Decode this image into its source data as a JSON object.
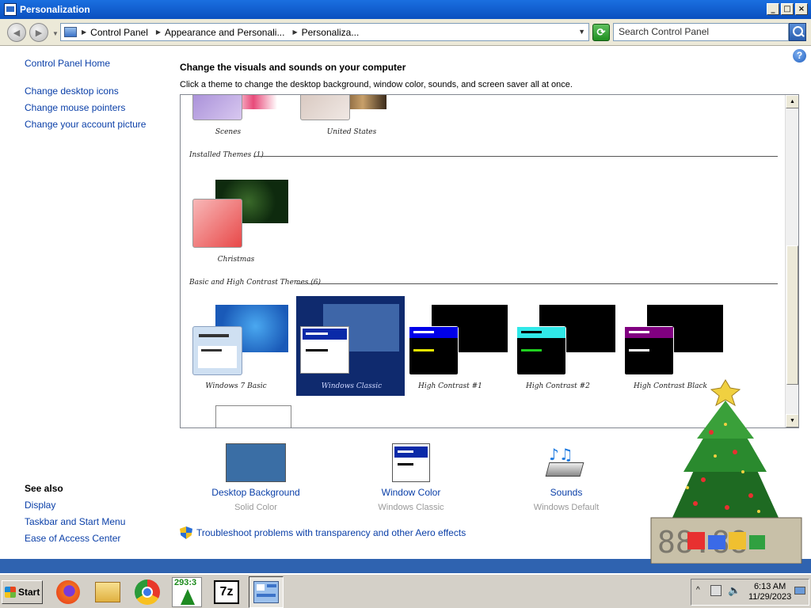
{
  "window": {
    "title": "Personalization"
  },
  "address": {
    "crumbs": [
      "Control Panel",
      "Appearance and Personali...",
      "Personaliza..."
    ],
    "search_placeholder": "Search Control Panel"
  },
  "left_pane": {
    "home": "Control Panel Home",
    "links": [
      "Change desktop icons",
      "Change mouse pointers",
      "Change your account picture"
    ],
    "see_also_title": "See also",
    "see_also": [
      "Display",
      "Taskbar and Start Menu",
      "Ease of Access Center"
    ]
  },
  "main": {
    "heading": "Change the visuals and sounds on your computer",
    "subheading": "Click a theme to change the desktop background, window color, sounds, and screen saver all at once."
  },
  "themes": {
    "top_row": [
      "Scenes",
      "United States"
    ],
    "installed_header": "Installed Themes (1)",
    "installed": [
      "Christmas"
    ],
    "basic_header": "Basic and High Contrast Themes (6)",
    "basic": [
      "Windows 7 Basic",
      "Windows Classic",
      "High Contrast #1",
      "High Contrast #2",
      "High Contrast Black"
    ],
    "selected": "Windows Classic"
  },
  "settings": [
    {
      "title": "Desktop Background",
      "sub": "Solid Color"
    },
    {
      "title": "Window Color",
      "sub": "Windows Classic"
    },
    {
      "title": "Sounds",
      "sub": "Windows Default"
    }
  ],
  "troubleshoot": "Troubleshoot problems with transparency and other Aero effects",
  "taskbar": {
    "start": "Start",
    "tree_counter": "293:3",
    "time": "6:13 AM",
    "date": "11/29/2023"
  },
  "colors": {
    "accent": "#0a3fa8",
    "selected_theme_bg": "#0f2a6e",
    "desktop": "#3a6ea5"
  }
}
